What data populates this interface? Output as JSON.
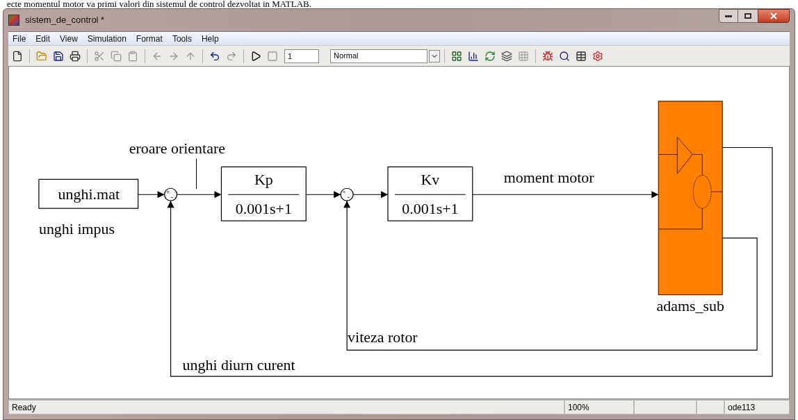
{
  "document_text": "ecte momentul motor va primi valori din sistemul de control dezvoltat in MATLAB.",
  "window": {
    "title": "sistem_de_control *"
  },
  "menu": [
    "File",
    "Edit",
    "View",
    "Simulation",
    "Format",
    "Tools",
    "Help"
  ],
  "toolbar": {
    "stop_time": "1",
    "mode": "Normal"
  },
  "diagram": {
    "source_block": {
      "text": "unghi.mat",
      "label": "unghi impus"
    },
    "sums": [
      {
        "signs": [
          "+",
          "-"
        ]
      },
      {
        "signs": [
          "+",
          "-"
        ]
      }
    ],
    "transfer_blocks": [
      {
        "numerator": "Kp",
        "denominator": "0.001s+1"
      },
      {
        "numerator": "Kv",
        "denominator": "0.001s+1"
      }
    ],
    "subsystem": {
      "label": "adams_sub",
      "color": "#ff8000"
    },
    "signal_labels": {
      "error": "eroare orientare",
      "torque": "moment motor",
      "speed": "viteza rotor",
      "angle": "unghi diurn curent"
    }
  },
  "status_bar": [
    "Ready",
    "100%",
    "ode113"
  ]
}
